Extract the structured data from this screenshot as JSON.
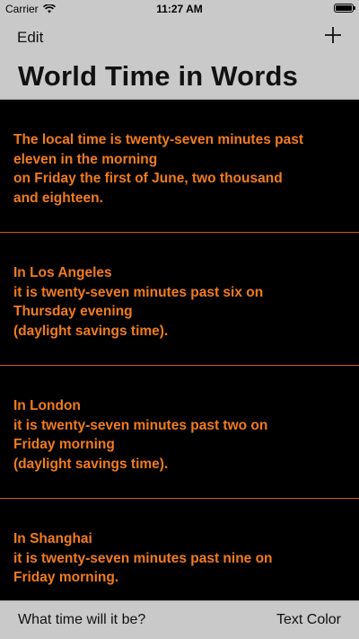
{
  "status_bar": {
    "carrier": "Carrier",
    "time": "11:27 AM",
    "battery_level": 1.0
  },
  "nav": {
    "edit_label": "Edit",
    "add_icon": "plus-icon",
    "title": "World Time in Words"
  },
  "cells": [
    {
      "text": "The local time is twenty-seven minutes past\neleven in the morning\non Friday the first of June, two thousand\nand eighteen."
    },
    {
      "text": "In Los Angeles\nit is twenty-seven minutes past six on\nThursday evening\n(daylight savings time)."
    },
    {
      "text": "In London\nit is twenty-seven minutes past two on\nFriday morning\n(daylight savings time)."
    },
    {
      "text": "In Shanghai\nit is twenty-seven minutes past nine on\nFriday morning."
    }
  ],
  "toolbar": {
    "left_label": "What time will it be?",
    "right_label": "Text Color"
  },
  "colors": {
    "text_accent": "#f27b1d",
    "separator": "#d45a0c",
    "bars": "#c9c9c9",
    "background": "#000000"
  }
}
